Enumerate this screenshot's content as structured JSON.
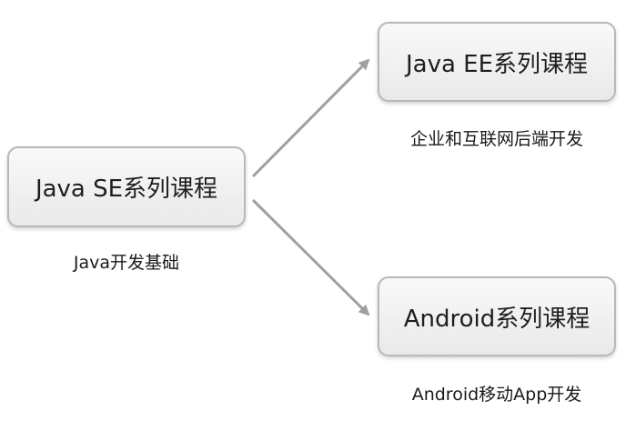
{
  "nodes": {
    "se": {
      "label": "Java SE系列课程",
      "caption": "Java开发基础"
    },
    "ee": {
      "label": "Java EE系列课程",
      "caption": "企业和互联网后端开发"
    },
    "android": {
      "label": "Android系列课程",
      "caption": "Android移动App开发"
    }
  },
  "edges": [
    {
      "from": "se",
      "to": "ee"
    },
    {
      "from": "se",
      "to": "android"
    }
  ],
  "colors": {
    "arrow": "#a0a0a0",
    "box_border": "#b8b8b8"
  }
}
